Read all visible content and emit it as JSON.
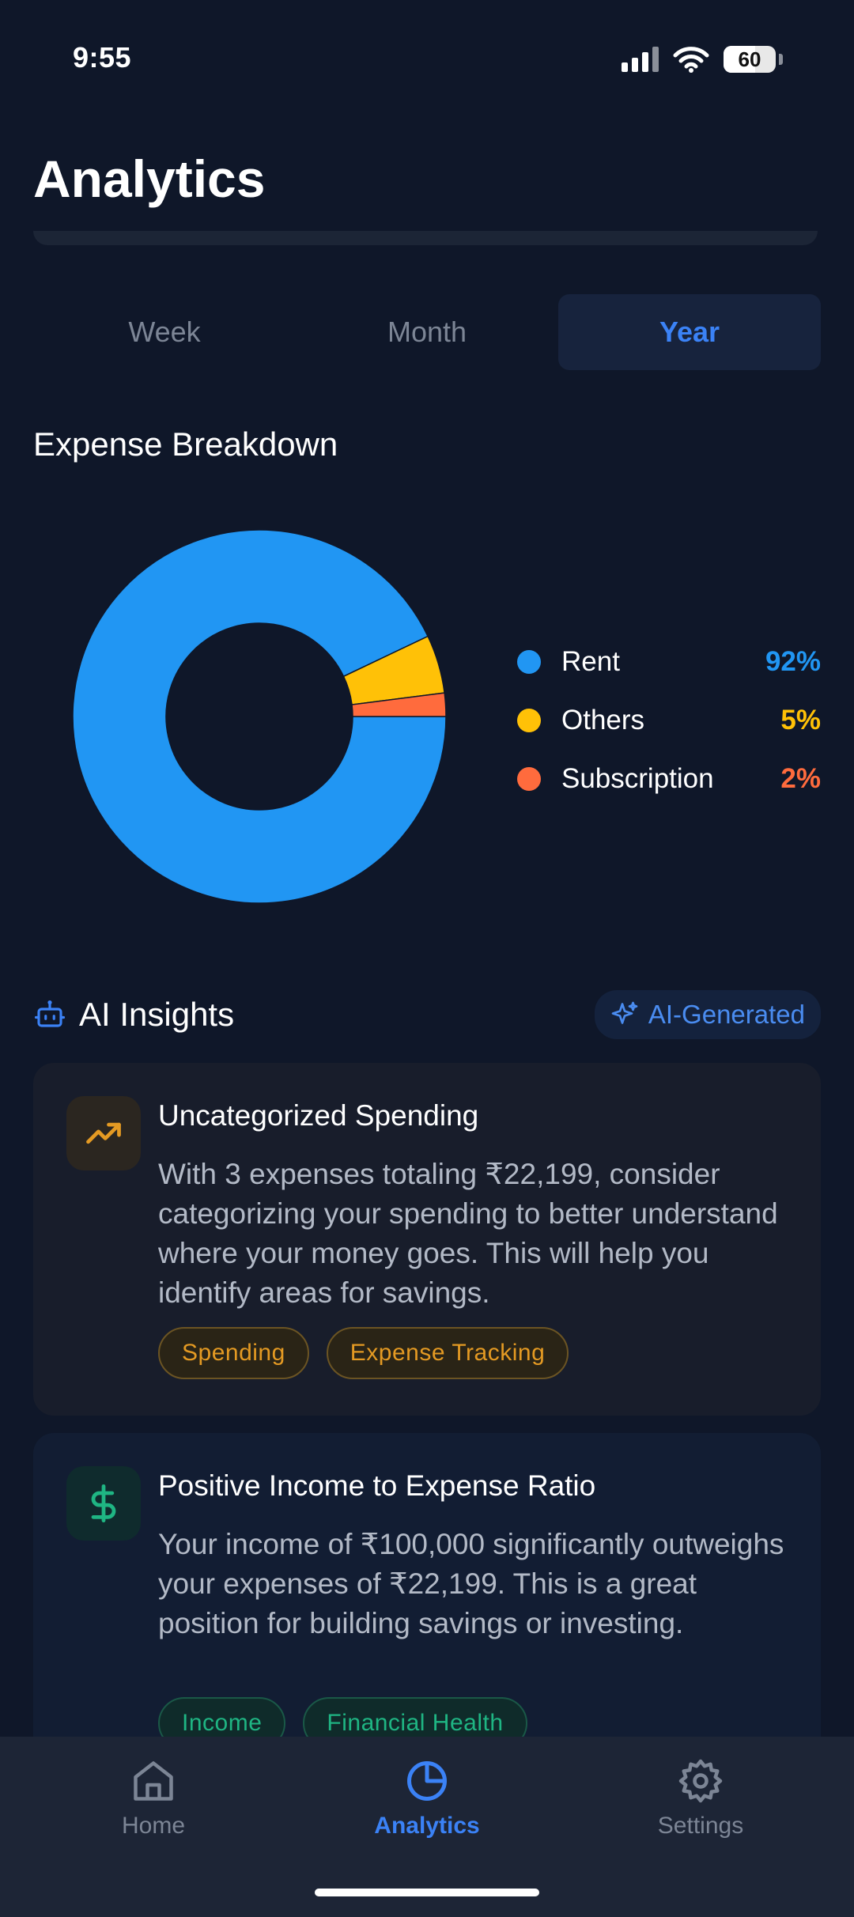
{
  "status_bar": {
    "time": "9:55",
    "battery": "60",
    "battery_level": 0.6,
    "icons": [
      "signal-icon",
      "wifi-icon",
      "battery-icon"
    ]
  },
  "header": {
    "title": "Analytics"
  },
  "period_tabs": [
    {
      "label": "Week",
      "active": false
    },
    {
      "label": "Month",
      "active": false
    },
    {
      "label": "Year",
      "active": true
    }
  ],
  "expense_breakdown": {
    "title": "Expense Breakdown",
    "chart_data": {
      "type": "pie",
      "style": "donut",
      "categories": [
        "Rent",
        "Others",
        "Subscription"
      ],
      "values": [
        92,
        5,
        2
      ],
      "labels": [
        "92%",
        "5%",
        "2%"
      ],
      "colors": [
        "#2196f3",
        "#ffc107",
        "#ff6b3d"
      ],
      "legend": "right"
    }
  },
  "ai_insights": {
    "title": "AI Insights",
    "badge": "AI-Generated",
    "cards": [
      {
        "icon": "trending-up-icon",
        "title": "Uncategorized Spending",
        "body": "With 3 expenses totaling ₹22,199, consider categorizing your spending to better understand where your money goes. This will help you identify areas for savings.",
        "tags": [
          "Spending",
          "Expense Tracking"
        ]
      },
      {
        "icon": "dollar-icon",
        "title": "Positive Income to Expense Ratio",
        "body": "Your income of ₹100,000 significantly outweighs your expenses of ₹22,199. This is a great position for building savings or investing.",
        "tags": [
          "Income",
          "Financial Health"
        ]
      }
    ]
  },
  "bottom_nav": [
    {
      "label": "Home",
      "icon": "home-icon",
      "active": false
    },
    {
      "label": "Analytics",
      "icon": "pie-chart-icon",
      "active": true
    },
    {
      "label": "Settings",
      "icon": "gear-icon",
      "active": false
    }
  ],
  "colors": {
    "background": "#0f1729",
    "accent": "#3b82f6",
    "amber": "#e49a23",
    "green": "#1fb583"
  }
}
